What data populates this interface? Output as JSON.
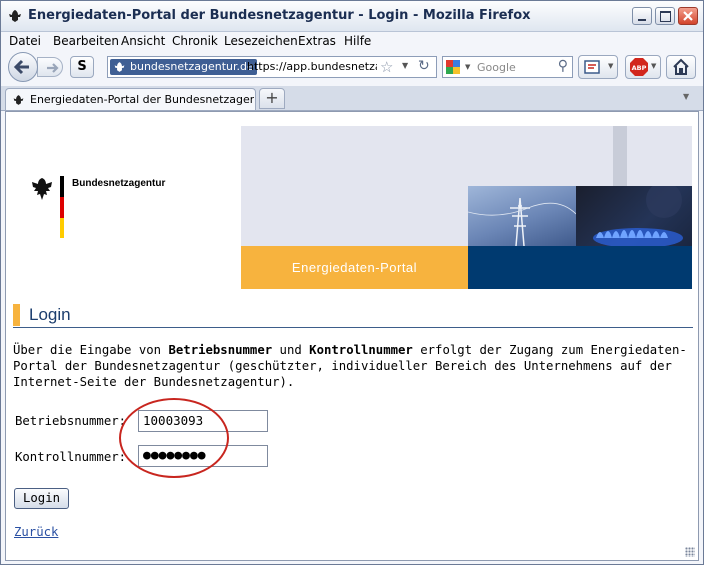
{
  "window": {
    "title": "Energiedaten-Portal der Bundesnetzagentur - Login - Mozilla Firefox"
  },
  "menu": [
    {
      "label": "Datei"
    },
    {
      "label": "Bearbeiten"
    },
    {
      "label": "Ansicht"
    },
    {
      "label": "Chronik"
    },
    {
      "label": "Lesezeichen"
    },
    {
      "label": "Extras"
    },
    {
      "label": "Hilfe"
    }
  ],
  "nav": {
    "site_identity": "bundesnetzagentur.de",
    "url": "https://app.bundesnetzagentur.de",
    "search_placeholder": "Google",
    "s_button": "S"
  },
  "tab": {
    "label": "Energiedaten-Portal der Bundesnetzagentur..."
  },
  "page": {
    "logo_text": "Bundesnetzagentur",
    "banner_title": "Energiedaten-Portal",
    "section_title": "Login",
    "intro_part1": "Über die Eingabe von ",
    "intro_bold1": "Betriebsnummer",
    "intro_part2": " und ",
    "intro_bold2": "Kontrollnummer",
    "intro_part3": " erfolgt der Zugang zum Energiedaten-Portal der Bundesnetzagentur (geschützter, individueller Bereich des Unternehmens auf der Internet-Seite der Bundesnetzagentur).",
    "betriebsnummer_label": "Betriebsnummer:",
    "betriebsnummer_value": "10003093",
    "kontrollnummer_label": "Kontrollnummer:",
    "kontrollnummer_value": "●●●●●●●●",
    "login_button": "Login",
    "back_link": "Zurück"
  },
  "colors": {
    "accent_orange": "#f7b33e",
    "brand_blue": "#003a70",
    "annotation_red": "#c8261f"
  }
}
